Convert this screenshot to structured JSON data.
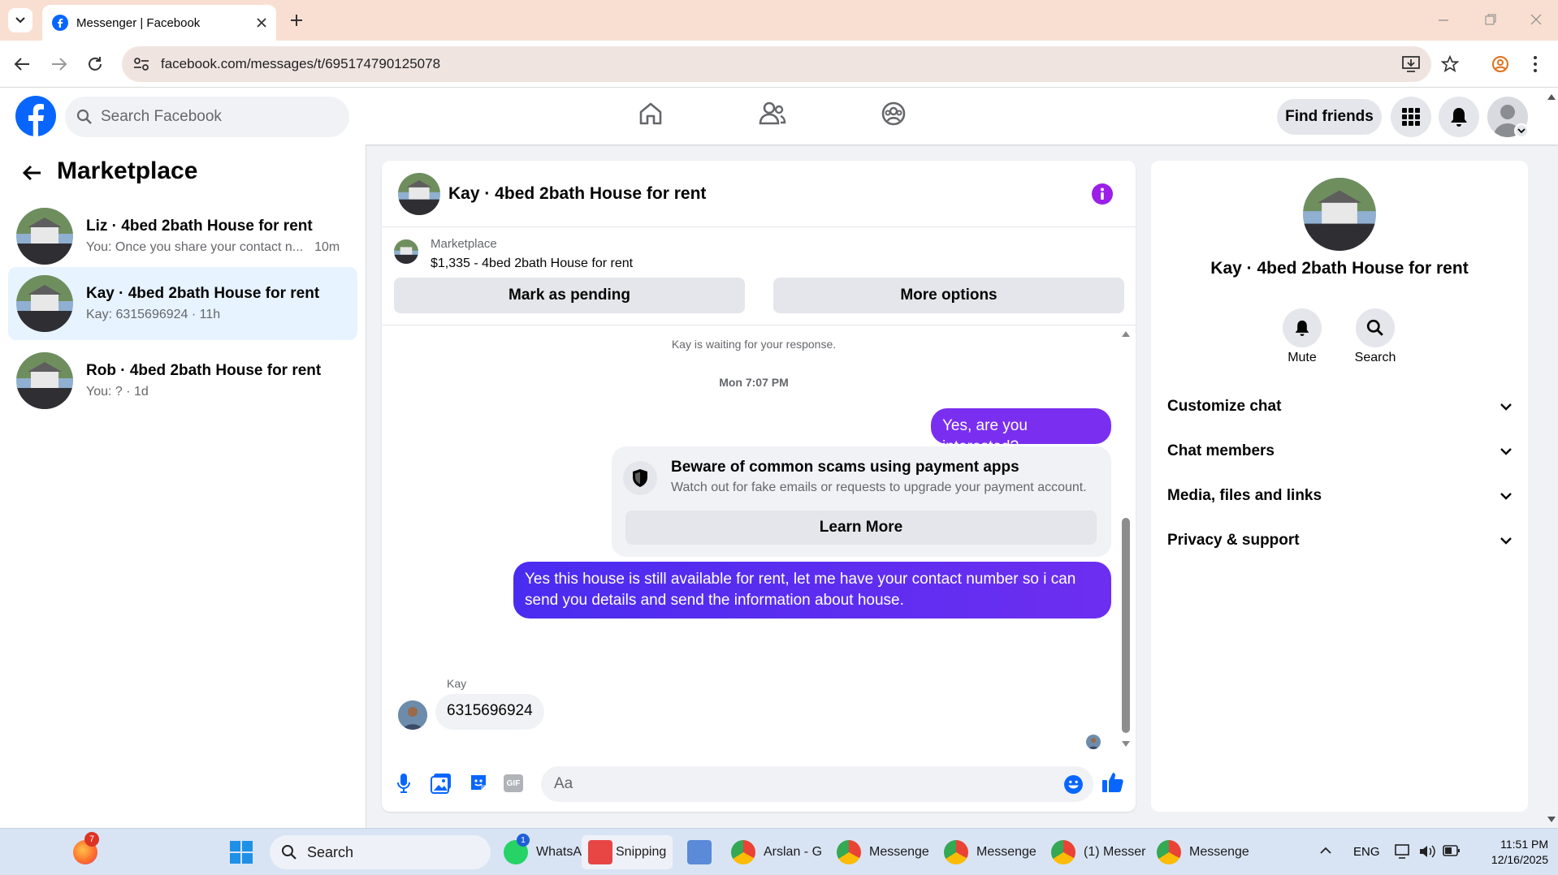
{
  "browser": {
    "tab_title": "Messenger | Facebook",
    "url": "facebook.com/messages/t/695174790125078"
  },
  "header": {
    "search_placeholder": "Search Facebook",
    "find_friends": "Find friends"
  },
  "sidebar": {
    "title": "Marketplace",
    "conversations": [
      {
        "name": "Liz · 4bed 2bath House for rent",
        "preview": "You: Once you share your contact n...",
        "time": "10m"
      },
      {
        "name": "Kay · 4bed 2bath House for rent",
        "preview": "Kay: 6315696924 · 11h",
        "time": ""
      },
      {
        "name": "Rob · 4bed 2bath House for rent",
        "preview": "You: ? · 1d",
        "time": ""
      }
    ]
  },
  "chat": {
    "title": "Kay · 4bed 2bath House for rent",
    "listing_source": "Marketplace",
    "listing_text": "$1,335 - 4bed 2bath House for rent",
    "mark_pending": "Mark as pending",
    "more_options": "More options",
    "waiting": "Kay is waiting for your response.",
    "timestamp": "Mon 7:07 PM",
    "msg1": "Yes, are you interested?",
    "scam_title": "Beware of common scams using payment apps",
    "scam_body": "Watch out for fake emails or requests to upgrade your payment account.",
    "learn_more": "Learn More",
    "msg2": "Yes this house is still available for rent, let me have your contact number so i can send you details and send the information about house.",
    "sender": "Kay",
    "msg3": "6315696924",
    "input_placeholder": "Aa",
    "gif": "GIF"
  },
  "details": {
    "title": "Kay · 4bed 2bath House for rent",
    "mute": "Mute",
    "search": "Search",
    "sections": [
      "Customize chat",
      "Chat members",
      "Media, files and links",
      "Privacy & support"
    ]
  },
  "taskbar": {
    "search": "Search",
    "badge_browser": "7",
    "badge_whatsapp": "1",
    "apps": [
      "WhatsA",
      "Snipping",
      "Arslan - G",
      "Messenge",
      "Messenge",
      "(1) Messer",
      "Messenge"
    ],
    "lang": "ENG",
    "time": "11:51 PM",
    "date": "12/16/2025"
  },
  "colors": {
    "brand": "#0866ff",
    "accent": "#7a2ff0",
    "bubble_out": "#4f35f0"
  }
}
